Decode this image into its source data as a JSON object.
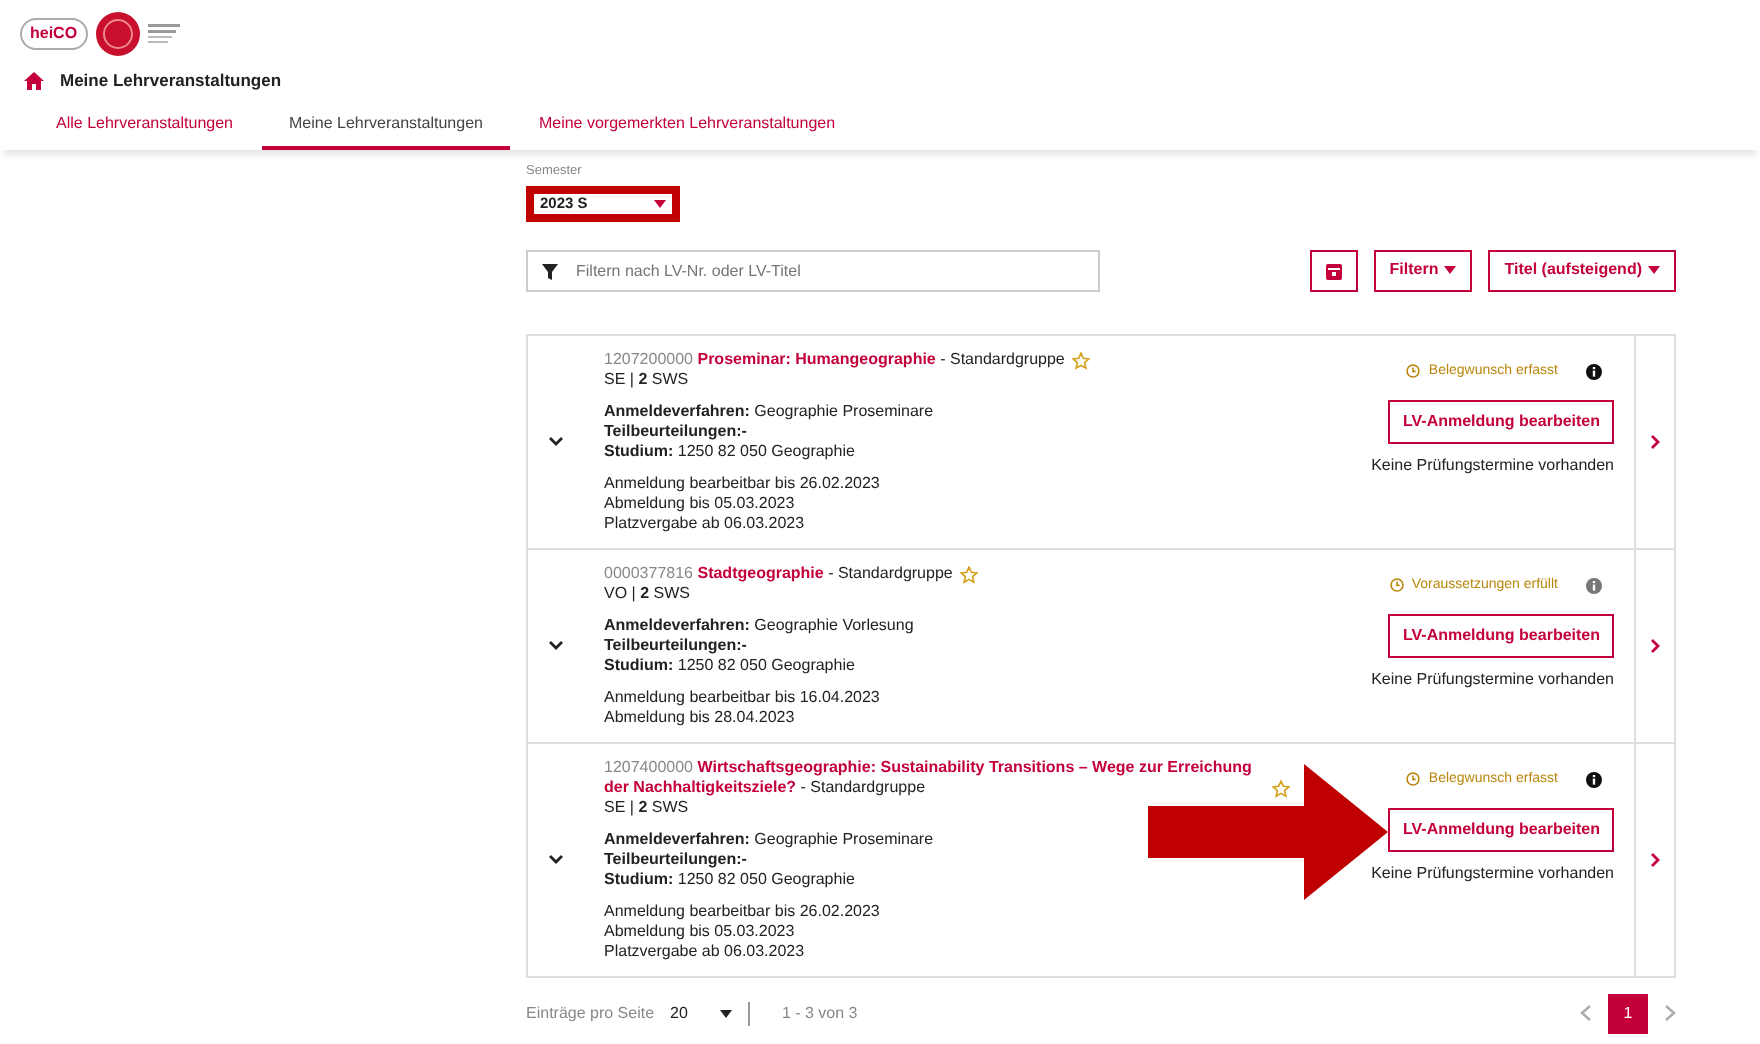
{
  "logo": {
    "text": "heiCO"
  },
  "breadcrumb": {
    "title": "Meine Lehrveranstaltungen"
  },
  "tabs": [
    {
      "label": "Alle Lehrveranstaltungen",
      "selected": false
    },
    {
      "label": "Meine Lehrveranstaltungen",
      "selected": true
    },
    {
      "label": "Meine vorgemerkten Lehrveranstaltungen",
      "selected": false
    }
  ],
  "semester": {
    "label": "Semester",
    "value": "2023 S",
    "highlighted": true
  },
  "filter": {
    "placeholder": "Filtern nach LV-Nr. oder LV-Titel"
  },
  "toolbar": {
    "filter_button": "Filtern",
    "sort_button": "Titel (aufsteigend)"
  },
  "courses": [
    {
      "number": "1207200000",
      "title": "Proseminar: Humangeographie",
      "group": " - Standardgruppe",
      "type": "SE | **2** SWS",
      "procedure_label": "Anmeldeverfahren:",
      "procedure": "Geographie Proseminare",
      "assessments_label": "Teilbeurteilungen:-",
      "study_label": "Studium:",
      "study": "1250 82 050 Geographie",
      "dates": [
        "Anmeldung bearbeitbar bis 26.02.2023",
        "Abmeldung bis 05.03.2023",
        "Platzvergabe ab 06.03.2023"
      ],
      "status": "Belegwunsch erfasst",
      "info_dark": true,
      "button": "LV-Anmeldung bearbeiten",
      "exams": "Keine Prüfungstermine vorhanden",
      "arrow": false
    },
    {
      "number": "0000377816",
      "title": "Stadtgeographie",
      "group": " - Standardgruppe",
      "type": "VO | **2** SWS",
      "procedure_label": "Anmeldeverfahren:",
      "procedure": "Geographie Vorlesung",
      "assessments_label": "Teilbeurteilungen:-",
      "study_label": "Studium:",
      "study": "1250 82 050 Geographie",
      "dates": [
        "Anmeldung bearbeitbar bis 16.04.2023",
        "Abmeldung bis 28.04.2023"
      ],
      "status": "Voraussetzungen erfüllt",
      "info_dark": false,
      "button": "LV-Anmeldung bearbeiten",
      "exams": "Keine Prüfungstermine vorhanden",
      "arrow": false
    },
    {
      "number": "1207400000",
      "title": "Wirtschaftsgeographie: Sustainability Transitions – Wege zur Erreichung der Nachhaltigkeitsziele?",
      "group": " - Standardgruppe",
      "type": "SE | **2** SWS",
      "procedure_label": "Anmeldeverfahren:",
      "procedure": "Geographie Proseminare",
      "assessments_label": "Teilbeurteilungen:-",
      "study_label": "Studium:",
      "study": "1250 82 050 Geographie",
      "dates": [
        "Anmeldung bearbeitbar bis 26.02.2023",
        "Abmeldung bis 05.03.2023",
        "Platzvergabe ab 06.03.2023"
      ],
      "status": "Belegwunsch erfasst",
      "info_dark": true,
      "button": "LV-Anmeldung bearbeiten",
      "exams": "Keine Prüfungstermine vorhanden",
      "arrow": true
    }
  ],
  "pagination": {
    "per_page_label": "Einträge pro Seite",
    "per_page": "20",
    "range": "1 - 3 von 3",
    "pages": [
      {
        "label": "1",
        "selected": true
      }
    ]
  }
}
